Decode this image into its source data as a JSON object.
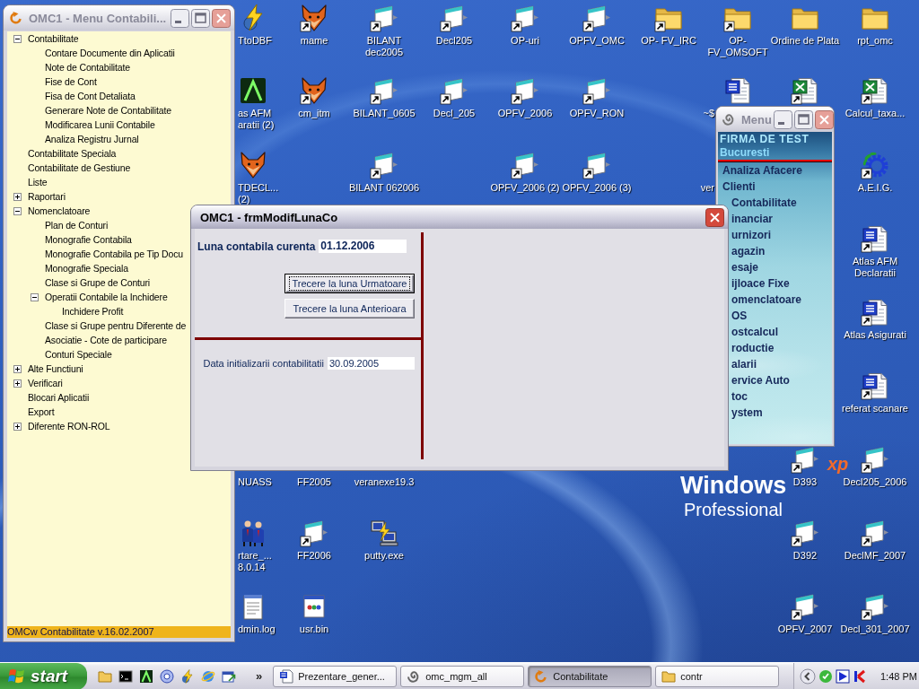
{
  "desktop": {
    "wallpaper": {
      "logo": "Windows",
      "logo_mark": "xp",
      "edition": "Professional"
    },
    "icons": [
      {
        "label": "TtoDBF",
        "kind": "bolt",
        "shortcut": false
      },
      {
        "label": "mame",
        "kind": "fox",
        "shortcut": true
      },
      {
        "label": "BILANT dec2005",
        "kind": "file",
        "shortcut": true
      },
      {
        "label": "Decl205",
        "kind": "file",
        "shortcut": true
      },
      {
        "label": "OP-uri",
        "kind": "file",
        "shortcut": true
      },
      {
        "label": "OPFV_OMC",
        "kind": "file",
        "shortcut": true
      },
      {
        "label": "OP- FV_IRC",
        "kind": "folder",
        "shortcut": true
      },
      {
        "label": "OP- FV_OMSOFT",
        "kind": "folder",
        "shortcut": true
      },
      {
        "label": "Ordine de Plata",
        "kind": "folder",
        "shortcut": false
      },
      {
        "label": "rpt_omc",
        "kind": "folder",
        "shortcut": false
      },
      {
        "label": "as AFM aratii (2)",
        "kind": "glow",
        "shortcut": false
      },
      {
        "label": "cm_itm",
        "kind": "fox",
        "shortcut": true
      },
      {
        "label": "BILANT_0605",
        "kind": "file",
        "shortcut": true
      },
      {
        "label": "Decl_205",
        "kind": "file",
        "shortcut": true
      },
      {
        "label": "OPFV_2006",
        "kind": "file",
        "shortcut": true
      },
      {
        "label": "OPFV_RON",
        "kind": "file",
        "shortcut": true
      },
      {
        "label": "~$",
        "kind": "word",
        "shortcut": false
      },
      {
        "kind": "excel",
        "shortcut": true
      },
      {
        "label": "Calcul_taxa...",
        "kind": "excel",
        "shortcut": true
      },
      {
        "label": "TDECL... (2)",
        "kind": "fox",
        "shortcut": false
      },
      {
        "label": "BILANT 062006",
        "kind": "file",
        "shortcut": true
      },
      {
        "label": "OPFV_2006 (2)",
        "kind": "file",
        "shortcut": true
      },
      {
        "label": "OPFV_2006 (3)",
        "kind": "file",
        "shortcut": true
      },
      {
        "label": "ver"
      },
      {
        "label": "A.E.I.G.",
        "kind": "gear",
        "shortcut": true
      },
      {
        "label": "Atlas AFM Declaratii",
        "kind": "word",
        "shortcut": true
      },
      {
        "label": "Atlas Asigurati",
        "kind": "word",
        "shortcut": true
      },
      {
        "label": "referat scanare",
        "kind": "word",
        "shortcut": true
      },
      {
        "label": "NUASS"
      },
      {
        "label": "FF2005"
      },
      {
        "label": "veranexe19.3"
      },
      {
        "label": "D393",
        "kind": "file",
        "shortcut": true
      },
      {
        "label": "Decl205_2006",
        "kind": "file",
        "shortcut": true
      },
      {
        "label": "rtare_... 8.0.14",
        "kind": "people",
        "shortcut": false
      },
      {
        "label": "FF2006",
        "kind": "file",
        "shortcut": true
      },
      {
        "label": "putty.exe",
        "kind": "putty",
        "shortcut": false
      },
      {
        "label": "D392",
        "kind": "file",
        "shortcut": true
      },
      {
        "label": "DeclMF_2007",
        "kind": "file",
        "shortcut": true
      },
      {
        "label": "dmin.log",
        "kind": "notepad",
        "shortcut": false
      },
      {
        "label": "usr.bin",
        "kind": "app",
        "shortcut": false
      },
      {
        "label": "OPFV_2007",
        "kind": "file",
        "shortcut": true
      },
      {
        "label": "Decl_301_2007",
        "kind": "file",
        "shortcut": true
      }
    ]
  },
  "tree_window": {
    "title": "OMC1 - Menu Contabili...",
    "active": false,
    "tree": [
      {
        "label": "Contabilitate",
        "kind": "branch",
        "expanded": true,
        "children": [
          {
            "label": "Contare Documente din Aplicatii",
            "kind": "leaf"
          },
          {
            "label": "Note de Contabilitate",
            "kind": "leaf"
          },
          {
            "label": "Fise de Cont",
            "kind": "leaf"
          },
          {
            "label": "Fisa de Cont Detaliata",
            "kind": "leaf"
          },
          {
            "label": "Generare Note de Contabilitate",
            "kind": "leaf"
          },
          {
            "label": "Modificarea Lunii Contabile",
            "kind": "leaf"
          },
          {
            "label": "Analiza Registru Jurnal",
            "kind": "leaf"
          }
        ]
      },
      {
        "label": "Contabilitate Speciala",
        "kind": "leaf"
      },
      {
        "label": "Contabilitate de Gestiune",
        "kind": "leaf"
      },
      {
        "label": "Liste",
        "kind": "leaf"
      },
      {
        "label": "Raportari",
        "kind": "branch",
        "expanded": false
      },
      {
        "label": "Nomenclatoare",
        "kind": "branch",
        "expanded": true,
        "children": [
          {
            "label": "Plan de Conturi",
            "kind": "leaf"
          },
          {
            "label": "Monografie Contabila",
            "kind": "leaf"
          },
          {
            "label": "Monografie Contabila pe Tip Docu",
            "kind": "leaf"
          },
          {
            "label": "Monografie Speciala",
            "kind": "leaf"
          },
          {
            "label": "Clase si Grupe de Conturi",
            "kind": "leaf"
          },
          {
            "label": "Operatii Contabile la Inchidere",
            "kind": "branch",
            "expanded": true,
            "children": [
              {
                "label": "Inchidere Profit",
                "kind": "leaf"
              }
            ]
          },
          {
            "label": "Clase si Grupe pentru Diferente de",
            "kind": "leaf"
          },
          {
            "label": "Asociatie - Cote de participare",
            "kind": "leaf"
          },
          {
            "label": "Conturi Speciale",
            "kind": "leaf"
          }
        ]
      },
      {
        "label": "Alte Functiuni",
        "kind": "branch",
        "expanded": false
      },
      {
        "label": "Verificari",
        "kind": "branch",
        "expanded": false
      },
      {
        "label": "Blocari Aplicatii",
        "kind": "leaf"
      },
      {
        "label": "Export",
        "kind": "leaf"
      },
      {
        "label": "Diferente RON-ROL",
        "kind": "branch",
        "expanded": false
      }
    ],
    "status_bar": "OMCw Contabilitate v.16.02.2007"
  },
  "menu_window": {
    "title": "Menu",
    "active": false,
    "company": "FIRMA DE TEST",
    "city": "Bucuresti",
    "items": [
      "Analiza Afacere",
      "Clienti",
      "Contabilitate",
      "inanciar",
      "urnizori",
      "agazin",
      "esaje",
      "ijloace Fixe",
      "omenclatoare",
      "OS",
      "ostcalcul",
      "roductie",
      "alarii",
      "ervice Auto",
      "toc",
      "ystem"
    ]
  },
  "dialog": {
    "title": "OMC1 - frmModifLunaCo",
    "active": true,
    "current_month": {
      "label": "Luna contabila curenta",
      "value": "01.12.2006"
    },
    "buttons": [
      {
        "label": "Trecere la luna Urmatoare",
        "focused": true
      },
      {
        "label": "Trecere la luna Anterioara",
        "focused": false
      }
    ],
    "init_date": {
      "label": "Data initializarii contabilitatii",
      "value": "30.09.2005"
    }
  },
  "taskbar": {
    "start": "start",
    "more": "»",
    "tasks": [
      {
        "label": "Prezentare_gener...",
        "kind": "document",
        "selected": false
      },
      {
        "label": "omc_mgm_all",
        "kind": "spiral",
        "selected": false
      },
      {
        "label": "Contabilitate",
        "kind": "app",
        "selected": true
      },
      {
        "label": "contr",
        "kind": "folder",
        "selected": false
      }
    ],
    "clock": "1:48 PM"
  }
}
